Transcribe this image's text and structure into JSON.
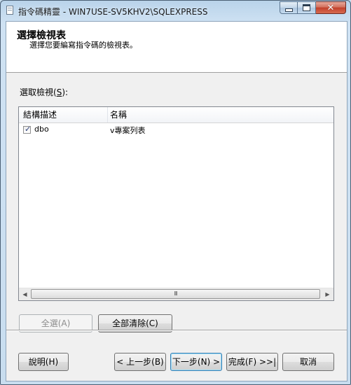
{
  "window": {
    "title": "指令碼精靈 - WIN7USE-SV5KHV2\\SQLEXPRESS",
    "min_glyph": "",
    "close_glyph": "✕"
  },
  "header": {
    "title": "選擇檢視表",
    "subtitle": "選擇您要編寫指令碼的檢視表。"
  },
  "select_label": {
    "prefix": "選取檢視(",
    "mnemonic": "S",
    "suffix": "):"
  },
  "table": {
    "columns": [
      "結構描述",
      "名稱"
    ],
    "rows": [
      {
        "checked": true,
        "schema": "dbo",
        "name": "v專案列表"
      }
    ]
  },
  "scrollbar": {
    "left_arrow": "◀",
    "right_arrow": "▶",
    "grip": "III"
  },
  "buttons": {
    "select_all": "全選(A)",
    "clear_all": "全部清除(C)",
    "help": "說明(H)",
    "back": "< 上一步(B)",
    "next": "下一步(N) >",
    "finish": "完成(F) >>|",
    "cancel": "取消"
  },
  "colors": {
    "titlebar": "#b9d3ea",
    "close": "#c2402b",
    "default_button_border": "#3c7fb1"
  }
}
